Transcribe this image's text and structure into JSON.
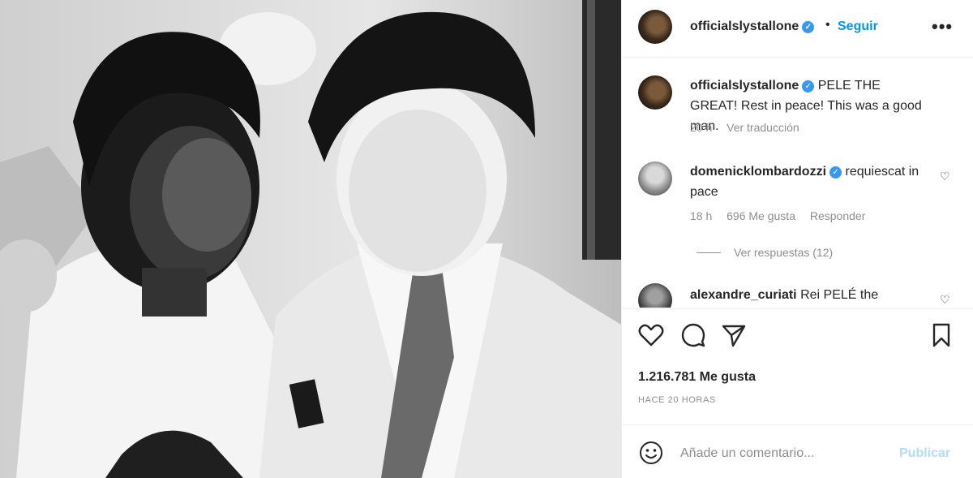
{
  "post": {
    "username": "officialslystallone",
    "follow_label": "Seguir",
    "dot": "•",
    "more_label": "•••"
  },
  "caption": {
    "username": "officialslystallone",
    "text": "PELE THE GREAT! Rest in peace! This was a good man.",
    "age": "20 h",
    "translate": "Ver traducción"
  },
  "comments": [
    {
      "username": "domenicklombardozzi",
      "text": "requiescat in pace",
      "age": "18 h",
      "likes": "696 Me gusta",
      "reply": "Responder",
      "view_replies": "Ver respuestas (12)"
    },
    {
      "username": "alexandre_curiati",
      "text": "Rei PELÉ the"
    }
  ],
  "stats": {
    "likes": "1.216.781 Me gusta",
    "time": "HACE 20 HORAS"
  },
  "composer": {
    "placeholder": "Añade un comentario...",
    "publish": "Publicar"
  },
  "icons": {
    "like": "heart-icon",
    "comment": "comment-icon",
    "share": "send-icon",
    "save": "bookmark-icon",
    "emoji": "emoji-icon",
    "verified": "verified-badge-icon"
  },
  "colors": {
    "accent": "#0095f6",
    "publish_disabled": "#b3dbff",
    "verified": "#3897f0",
    "muted": "#8e8e8e"
  }
}
